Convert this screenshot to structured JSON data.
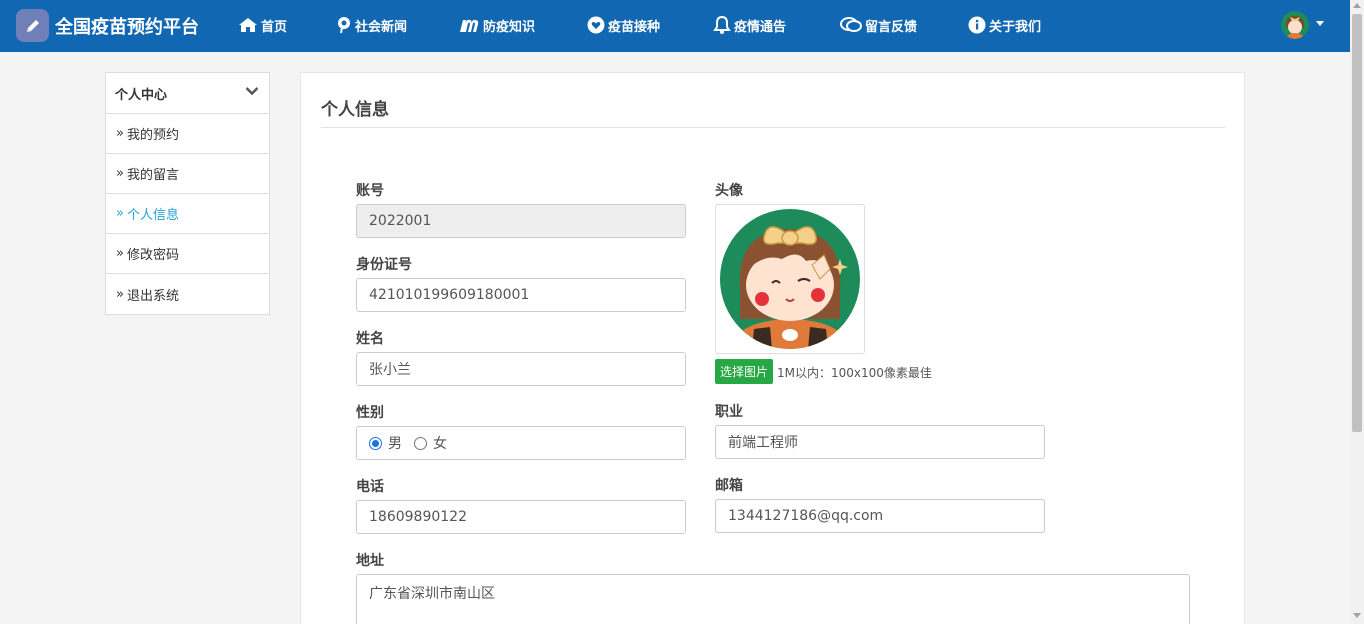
{
  "colors": {
    "navbar": "#1167b1",
    "accent": "#1fa3d5",
    "button_green": "#28a745"
  },
  "brand": {
    "title": "全国疫苗预约平台",
    "logo_icon": "pencil-icon"
  },
  "nav": [
    {
      "label": "首页",
      "icon": "home-icon"
    },
    {
      "label": "社会新闻",
      "icon": "pinterest-icon"
    },
    {
      "label": "防疫知识",
      "icon": "m-icon"
    },
    {
      "label": "疫苗接种",
      "icon": "heart-icon"
    },
    {
      "label": "疫情通告",
      "icon": "bell-icon"
    },
    {
      "label": "留言反馈",
      "icon": "chat-icon"
    },
    {
      "label": "关于我们",
      "icon": "info-icon"
    }
  ],
  "sidebar": {
    "title": "个人中心",
    "items": [
      {
        "label": "我的预约",
        "active": false
      },
      {
        "label": "我的留言",
        "active": false
      },
      {
        "label": "个人信息",
        "active": true
      },
      {
        "label": "修改密码",
        "active": false
      },
      {
        "label": "退出系统",
        "active": false
      }
    ]
  },
  "panel": {
    "title": "个人信息"
  },
  "form": {
    "account": {
      "label": "账号",
      "value": "2022001"
    },
    "id_number": {
      "label": "身份证号",
      "value": "421010199609180001"
    },
    "name": {
      "label": "姓名",
      "value": "张小兰"
    },
    "gender": {
      "label": "性别",
      "options": [
        "男",
        "女"
      ],
      "selected": "男"
    },
    "phone": {
      "label": "电话",
      "value": "18609890122"
    },
    "avatar": {
      "label": "头像",
      "button": "选择图片",
      "hint": "1M以内：100x100像素最佳"
    },
    "job": {
      "label": "职业",
      "value": "前端工程师"
    },
    "email": {
      "label": "邮箱",
      "value": "1344127186@qq.com"
    },
    "address": {
      "label": "地址",
      "value": "广东省深圳市南山区"
    }
  }
}
